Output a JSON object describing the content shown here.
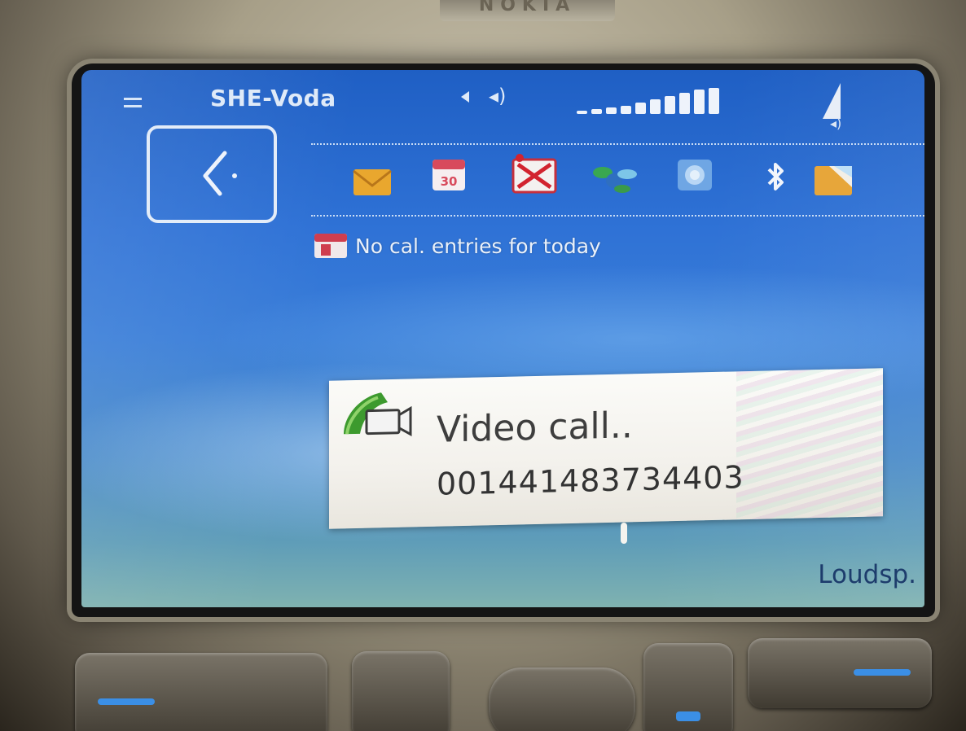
{
  "device": {
    "brand": "NOKIA"
  },
  "status_bar": {
    "operator": "SHE-Voda",
    "signal_levels": [
      4,
      6,
      8,
      10,
      14,
      18,
      22,
      26,
      30,
      32
    ]
  },
  "home": {
    "calendar_message": "No cal. entries for today",
    "shortcuts": [
      {
        "icon": "mail-icon"
      },
      {
        "icon": "calendar-icon"
      },
      {
        "icon": "messaging-icon"
      },
      {
        "icon": "connectivity-icon"
      },
      {
        "icon": "web-icon"
      },
      {
        "icon": "bluetooth-icon"
      },
      {
        "icon": "inbox-icon"
      }
    ]
  },
  "call_popup": {
    "status": "Video call..",
    "number": "001441483734403"
  },
  "softkeys": {
    "right": "Loudsp."
  },
  "colors": {
    "screen_blue": "#2f72d6",
    "popup_bg": "#f7f6f2",
    "softkey_text": "#1d3c6c",
    "key_accent": "#3b8fe6"
  }
}
